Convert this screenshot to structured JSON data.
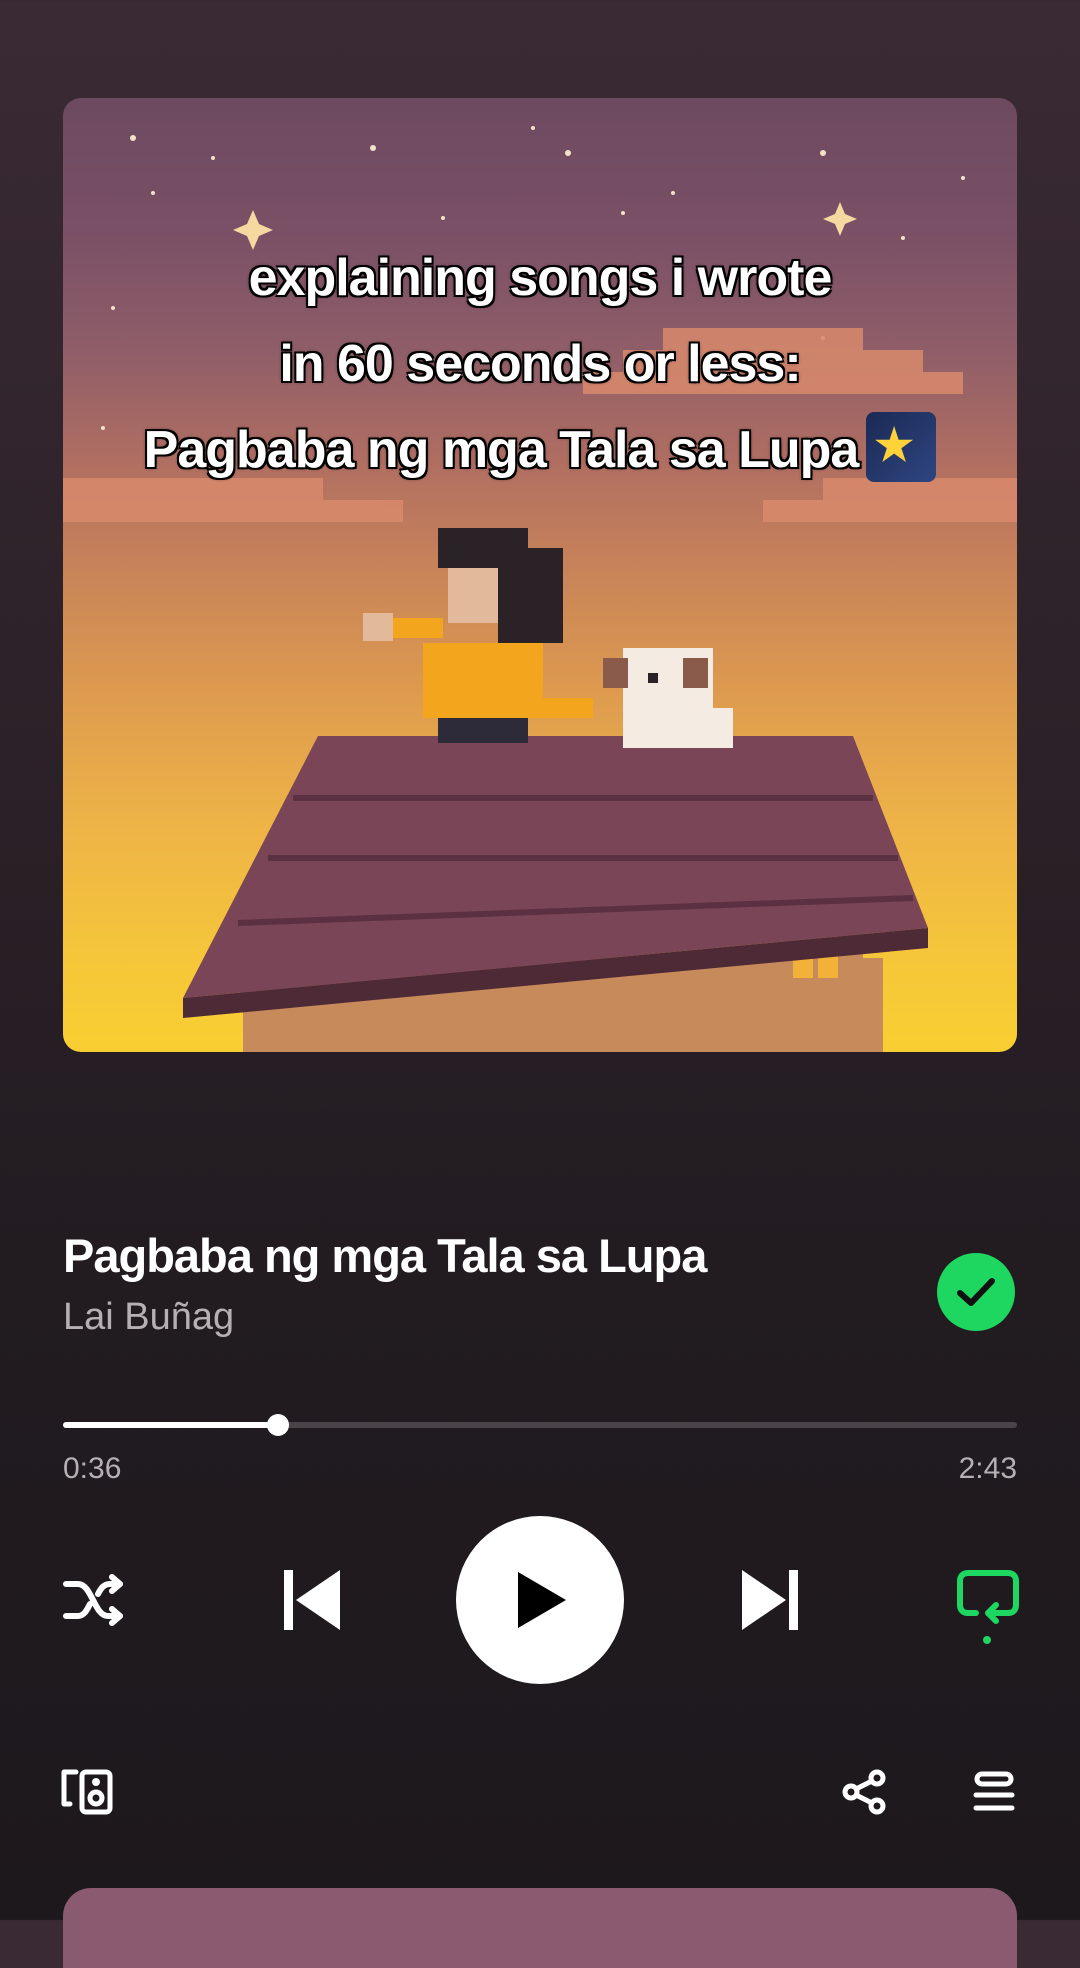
{
  "overlay": {
    "line1": "explaining songs i wrote",
    "line2": "in 60 seconds or less:",
    "line3": "Pagbaba ng mga Tala sa Lupa"
  },
  "now_playing": {
    "title": "Pagbaba ng mga Tala sa Lupa",
    "artist": "Lai Buñag",
    "liked": true
  },
  "progress": {
    "elapsed": "0:36",
    "total": "2:43",
    "fraction": 0.225
  },
  "controls": {
    "shuffle": "shuffle-icon",
    "previous": "skip-back-icon",
    "play": "play-icon",
    "next": "skip-forward-icon",
    "repeat": "repeat-icon"
  },
  "bottom_bar": {
    "devices": "connect-device-icon",
    "share": "share-icon",
    "queue": "queue-icon"
  },
  "colors": {
    "accent": "#1ed760",
    "background": "#2d2229"
  }
}
